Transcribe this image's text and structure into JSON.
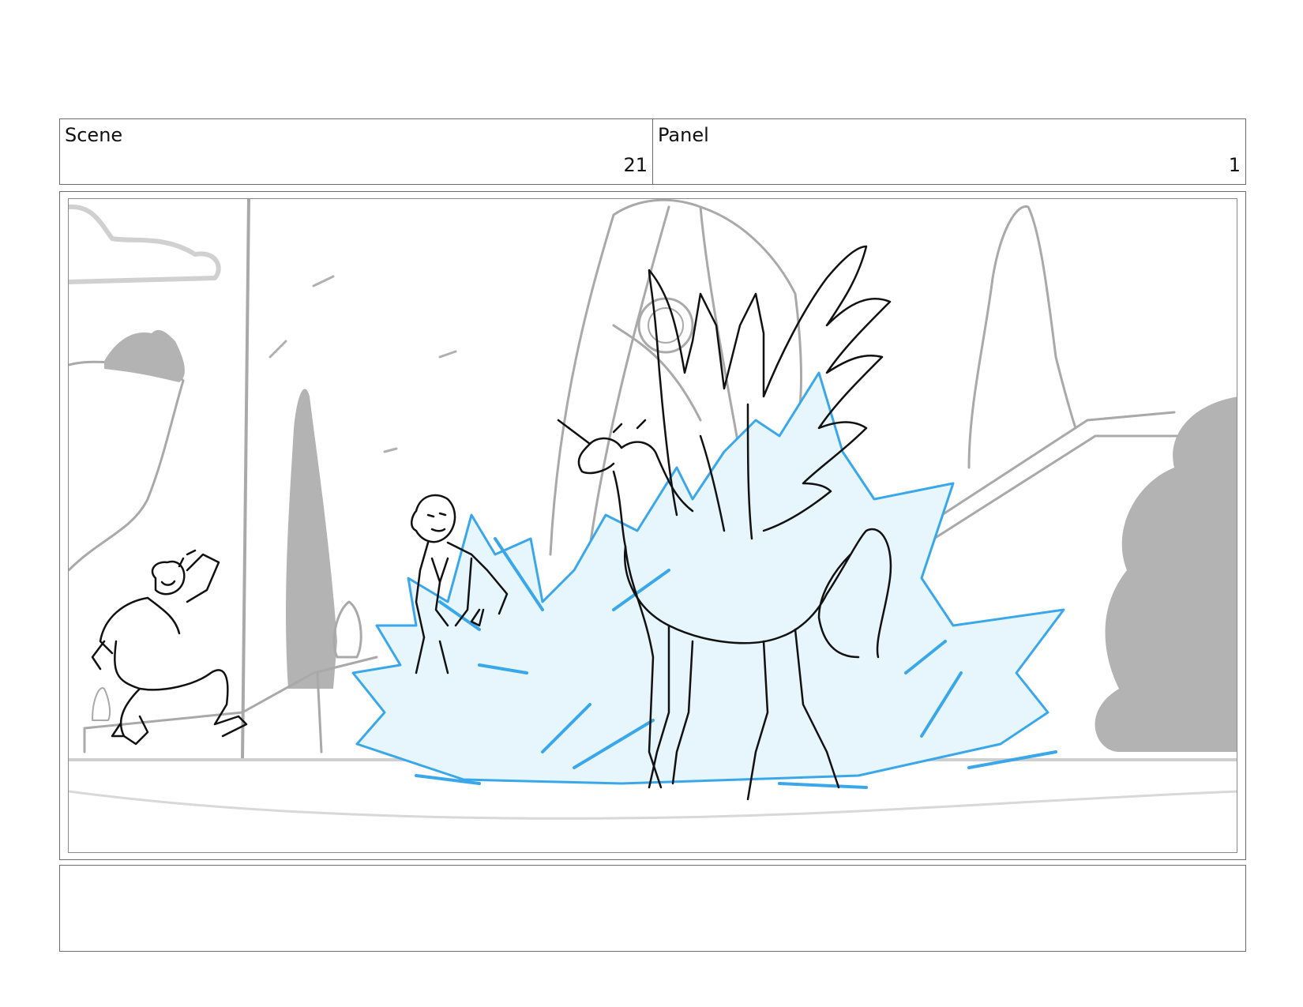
{
  "header": {
    "scene_label": "Scene",
    "scene_number": "21",
    "panel_label": "Panel",
    "panel_number": "1"
  },
  "artwork": {
    "colors": {
      "background_line": "#a9a9a9",
      "background_fill": "#b3b3b3",
      "character_line": "#111111",
      "magic_line": "#3aa7ea",
      "magic_fill": "#e6f6fc"
    }
  },
  "notes": {
    "text": ""
  }
}
